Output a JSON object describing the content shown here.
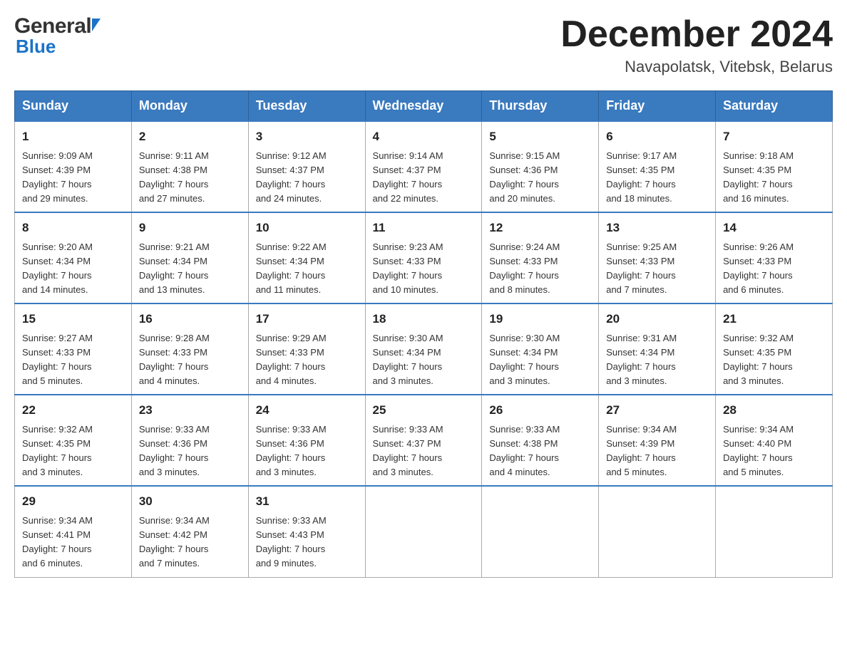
{
  "header": {
    "logo": {
      "general": "General",
      "blue": "Blue",
      "arrow": "▲"
    },
    "title": "December 2024",
    "location": "Navapolatsk, Vitebsk, Belarus"
  },
  "days_of_week": [
    "Sunday",
    "Monday",
    "Tuesday",
    "Wednesday",
    "Thursday",
    "Friday",
    "Saturday"
  ],
  "weeks": [
    [
      {
        "day": "1",
        "sunrise": "9:09 AM",
        "sunset": "4:39 PM",
        "daylight": "7 hours and 29 minutes."
      },
      {
        "day": "2",
        "sunrise": "9:11 AM",
        "sunset": "4:38 PM",
        "daylight": "7 hours and 27 minutes."
      },
      {
        "day": "3",
        "sunrise": "9:12 AM",
        "sunset": "4:37 PM",
        "daylight": "7 hours and 24 minutes."
      },
      {
        "day": "4",
        "sunrise": "9:14 AM",
        "sunset": "4:37 PM",
        "daylight": "7 hours and 22 minutes."
      },
      {
        "day": "5",
        "sunrise": "9:15 AM",
        "sunset": "4:36 PM",
        "daylight": "7 hours and 20 minutes."
      },
      {
        "day": "6",
        "sunrise": "9:17 AM",
        "sunset": "4:35 PM",
        "daylight": "7 hours and 18 minutes."
      },
      {
        "day": "7",
        "sunrise": "9:18 AM",
        "sunset": "4:35 PM",
        "daylight": "7 hours and 16 minutes."
      }
    ],
    [
      {
        "day": "8",
        "sunrise": "9:20 AM",
        "sunset": "4:34 PM",
        "daylight": "7 hours and 14 minutes."
      },
      {
        "day": "9",
        "sunrise": "9:21 AM",
        "sunset": "4:34 PM",
        "daylight": "7 hours and 13 minutes."
      },
      {
        "day": "10",
        "sunrise": "9:22 AM",
        "sunset": "4:34 PM",
        "daylight": "7 hours and 11 minutes."
      },
      {
        "day": "11",
        "sunrise": "9:23 AM",
        "sunset": "4:33 PM",
        "daylight": "7 hours and 10 minutes."
      },
      {
        "day": "12",
        "sunrise": "9:24 AM",
        "sunset": "4:33 PM",
        "daylight": "7 hours and 8 minutes."
      },
      {
        "day": "13",
        "sunrise": "9:25 AM",
        "sunset": "4:33 PM",
        "daylight": "7 hours and 7 minutes."
      },
      {
        "day": "14",
        "sunrise": "9:26 AM",
        "sunset": "4:33 PM",
        "daylight": "7 hours and 6 minutes."
      }
    ],
    [
      {
        "day": "15",
        "sunrise": "9:27 AM",
        "sunset": "4:33 PM",
        "daylight": "7 hours and 5 minutes."
      },
      {
        "day": "16",
        "sunrise": "9:28 AM",
        "sunset": "4:33 PM",
        "daylight": "7 hours and 4 minutes."
      },
      {
        "day": "17",
        "sunrise": "9:29 AM",
        "sunset": "4:33 PM",
        "daylight": "7 hours and 4 minutes."
      },
      {
        "day": "18",
        "sunrise": "9:30 AM",
        "sunset": "4:34 PM",
        "daylight": "7 hours and 3 minutes."
      },
      {
        "day": "19",
        "sunrise": "9:30 AM",
        "sunset": "4:34 PM",
        "daylight": "7 hours and 3 minutes."
      },
      {
        "day": "20",
        "sunrise": "9:31 AM",
        "sunset": "4:34 PM",
        "daylight": "7 hours and 3 minutes."
      },
      {
        "day": "21",
        "sunrise": "9:32 AM",
        "sunset": "4:35 PM",
        "daylight": "7 hours and 3 minutes."
      }
    ],
    [
      {
        "day": "22",
        "sunrise": "9:32 AM",
        "sunset": "4:35 PM",
        "daylight": "7 hours and 3 minutes."
      },
      {
        "day": "23",
        "sunrise": "9:33 AM",
        "sunset": "4:36 PM",
        "daylight": "7 hours and 3 minutes."
      },
      {
        "day": "24",
        "sunrise": "9:33 AM",
        "sunset": "4:36 PM",
        "daylight": "7 hours and 3 minutes."
      },
      {
        "day": "25",
        "sunrise": "9:33 AM",
        "sunset": "4:37 PM",
        "daylight": "7 hours and 3 minutes."
      },
      {
        "day": "26",
        "sunrise": "9:33 AM",
        "sunset": "4:38 PM",
        "daylight": "7 hours and 4 minutes."
      },
      {
        "day": "27",
        "sunrise": "9:34 AM",
        "sunset": "4:39 PM",
        "daylight": "7 hours and 5 minutes."
      },
      {
        "day": "28",
        "sunrise": "9:34 AM",
        "sunset": "4:40 PM",
        "daylight": "7 hours and 5 minutes."
      }
    ],
    [
      {
        "day": "29",
        "sunrise": "9:34 AM",
        "sunset": "4:41 PM",
        "daylight": "7 hours and 6 minutes."
      },
      {
        "day": "30",
        "sunrise": "9:34 AM",
        "sunset": "4:42 PM",
        "daylight": "7 hours and 7 minutes."
      },
      {
        "day": "31",
        "sunrise": "9:33 AM",
        "sunset": "4:43 PM",
        "daylight": "7 hours and 9 minutes."
      },
      null,
      null,
      null,
      null
    ]
  ],
  "labels": {
    "sunrise": "Sunrise:",
    "sunset": "Sunset:",
    "daylight": "Daylight:"
  }
}
